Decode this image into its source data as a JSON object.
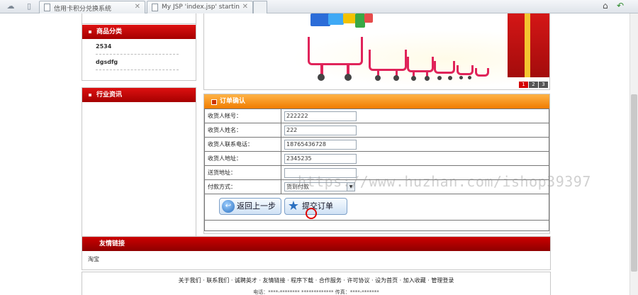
{
  "browser": {
    "tabs": [
      {
        "title": "信用卡积分兑换系统"
      },
      {
        "title": "My JSP 'index.jsp' starting p"
      }
    ]
  },
  "sidebar": {
    "categories_title": "商品分类",
    "categories": [
      "2534",
      "dgsdfg"
    ],
    "news_title": "行业资讯"
  },
  "banner": {
    "pages": [
      "1",
      "2",
      "3"
    ],
    "active_page": "1"
  },
  "order": {
    "title": "订单确认",
    "rows": [
      {
        "label": "收货人帐号：",
        "value": "222222"
      },
      {
        "label": "收货人姓名：",
        "value": "222"
      },
      {
        "label": "收货人联系电话：",
        "value": "18765436728"
      },
      {
        "label": "收货人地址：",
        "value": "2345235"
      },
      {
        "label": "送货地址：",
        "value": ""
      }
    ],
    "payment_label": "付款方式：",
    "payment_value": "货到付款",
    "back_button": "返回上一步",
    "submit_button": "提交订单"
  },
  "friends": {
    "title": "友情链接",
    "items": [
      "淘宝"
    ]
  },
  "footer": {
    "links": "关于我们 · 联系我们 · 诚聘英才 · 友情链接 · 程序下载 · 合作服务 · 许可协议 · 设为首页 · 加入收藏 · 管理登录",
    "contact": "电话：****-******** ************* 传真：****-*******"
  },
  "watermark": "https://www.huzhan.com/ishop39397",
  "colors": {
    "header_red": "#b00000",
    "order_orange": "#f07c00"
  }
}
